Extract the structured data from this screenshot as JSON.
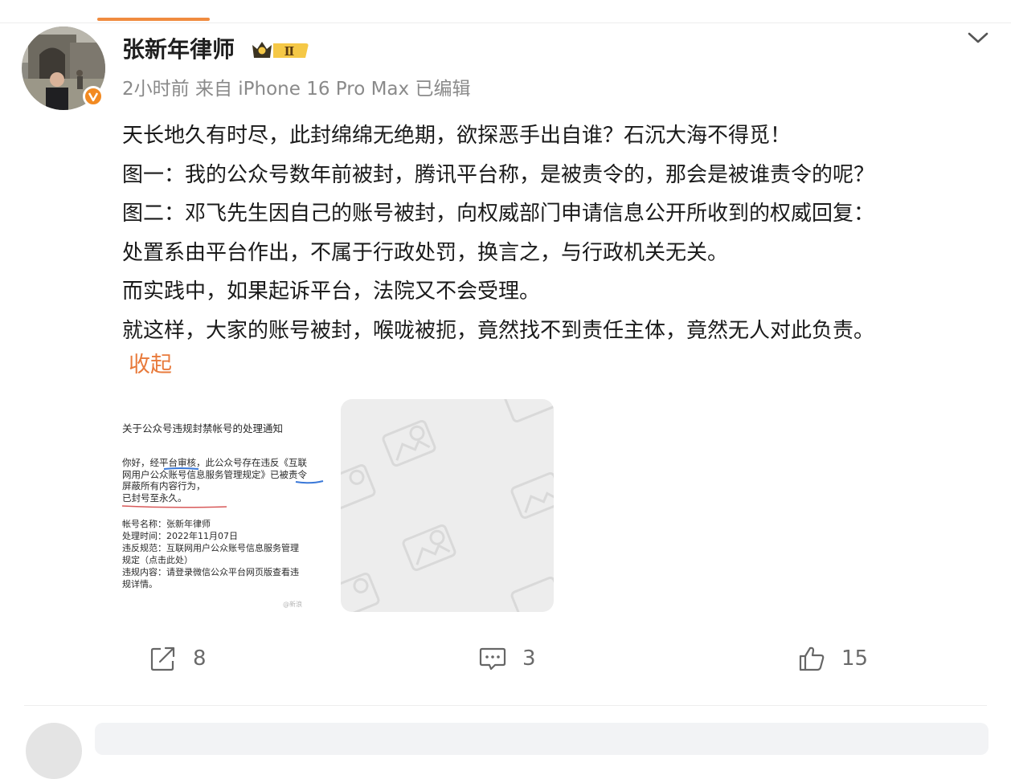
{
  "post": {
    "author": "张新年律师",
    "badge_level": "Ⅱ",
    "meta": "2小时前  来自 iPhone 16 Pro Max 已编辑",
    "content_lines": [
      "天长地久有时尽，此封绵绵无绝期，欲探恶手出自谁？石沉大海不得觅！",
      "图一：我的公众号数年前被封，腾讯平台称，是被责令的，那会是被谁责令的呢？",
      "图二：邓飞先生因自己的账号被封，向权威部门申请信息公开所收到的权威回复：",
      "处置系由平台作出，不属于行政处罚，换言之，与行政机关无关。",
      "而实践中，如果起诉平台，法院又不会受理。",
      "就这样，大家的账号被封，喉咙被扼，竟然找不到责任主体，竟然无人对此负责。"
    ],
    "collapse_label": "收起"
  },
  "image1": {
    "title": "关于公众号违规封禁帐号的处理通知",
    "body_lines": [
      "你好，经平台审核，此公众号存在违反《互联",
      "网用户公众账号信息服务管理规定》已被责令",
      "屏蔽所有内容行为，",
      "已封号至永久。"
    ],
    "info_lines": [
      "帐号名称：张新年律师",
      "处理时间：2022年11月07日",
      "违反规范：互联网用户公众账号信息服务管理",
      "规定（点击此处）",
      "违规内容：请登录微信公众平台网页版查看违",
      "规详情。"
    ],
    "watermark": "@新浪"
  },
  "actions": {
    "repost_count": "8",
    "comment_count": "3",
    "like_count": "15"
  },
  "colors": {
    "accent": "#e87a3b",
    "badge_orange": "#f28a22",
    "meta_gray": "#8a8a8a"
  }
}
